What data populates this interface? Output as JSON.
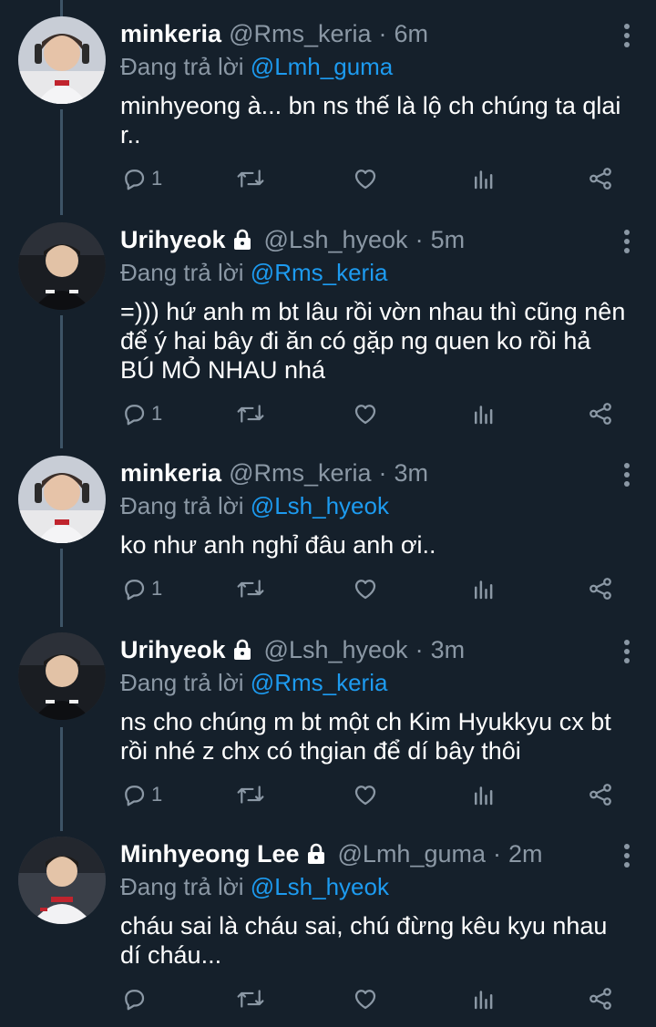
{
  "colors": {
    "background": "#15202b",
    "mention": "#1d9bf0",
    "secondary": "#8b98a5"
  },
  "reply_prefix": "Đang trả lời",
  "tweets": [
    {
      "name": "minkeria",
      "locked": false,
      "handle": "@Rms_keria",
      "time": "6m",
      "reply_to": "@Lmh_guma",
      "lines": [
        "minhyeong à... bn ns thế là lộ ch chúng ta qlai",
        "r.."
      ],
      "reply_count": "1",
      "icons": [
        "reply-icon",
        "retweet-icon",
        "like-icon",
        "stats-icon",
        "share-icon"
      ]
    },
    {
      "name": "Urihyeok",
      "locked": true,
      "handle": "@Lsh_hyeok",
      "time": "5m",
      "reply_to": "@Rms_keria",
      "lines": [
        "=))) hứ anh m bt lâu rồi vờn nhau thì cũng nên",
        "để ý hai bây đi ăn có gặp ng quen ko rồi hả",
        "BÚ MỎ NHAU nhá"
      ],
      "reply_count": "1",
      "icons": [
        "reply-icon",
        "retweet-icon",
        "like-icon",
        "stats-icon",
        "share-icon"
      ]
    },
    {
      "name": "minkeria",
      "locked": false,
      "handle": "@Rms_keria",
      "time": "3m",
      "reply_to": "@Lsh_hyeok",
      "lines": [
        "ko như anh nghỉ đâu anh ơi.."
      ],
      "reply_count": "1",
      "icons": [
        "reply-icon",
        "retweet-icon",
        "like-icon",
        "stats-icon",
        "share-icon"
      ]
    },
    {
      "name": "Urihyeok",
      "locked": true,
      "handle": "@Lsh_hyeok",
      "time": "3m",
      "reply_to": "@Rms_keria",
      "lines": [
        "ns cho chúng m bt một ch Kim Hyukkyu cx bt",
        "rồi nhé z chx có thgian để dí bây thôi"
      ],
      "reply_count": "1",
      "icons": [
        "reply-icon",
        "retweet-icon",
        "like-icon",
        "stats-icon",
        "share-icon"
      ]
    },
    {
      "name": "Minhyeong Lee",
      "locked": true,
      "handle": "@Lmh_guma",
      "time": "2m",
      "reply_to": "@Lsh_hyeok",
      "lines": [
        "cháu sai là cháu sai, chú đừng kêu kyu nhau",
        "dí cháu..."
      ],
      "reply_count": "",
      "icons": [
        "reply-icon",
        "retweet-icon",
        "like-icon",
        "stats-icon",
        "share-icon"
      ]
    }
  ]
}
